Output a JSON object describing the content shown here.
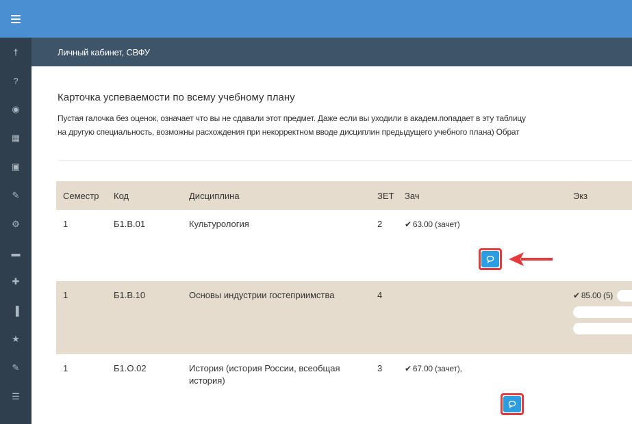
{
  "header": {
    "breadcrumb": "Личный кабинет, СВФУ"
  },
  "sidebar": {
    "items": [
      {
        "icon": "person-icon",
        "glyph": "†"
      },
      {
        "icon": "help-icon",
        "glyph": "?"
      },
      {
        "icon": "target-icon",
        "glyph": "◉"
      },
      {
        "icon": "table-icon",
        "glyph": "▦"
      },
      {
        "icon": "id-card-icon",
        "glyph": "▣"
      },
      {
        "icon": "edit-icon",
        "glyph": "✎"
      },
      {
        "icon": "cogs-icon",
        "glyph": "⚙"
      },
      {
        "icon": "book-icon",
        "glyph": "▬"
      },
      {
        "icon": "plus-square-icon",
        "glyph": "✚"
      },
      {
        "icon": "chart-icon",
        "glyph": "▐"
      },
      {
        "icon": "star-icon",
        "glyph": "★"
      },
      {
        "icon": "edit-icon",
        "glyph": "✎"
      },
      {
        "icon": "list-icon",
        "glyph": "☰"
      }
    ]
  },
  "page": {
    "title": "Карточка успеваемости по всему учебному плану",
    "desc_line1": "Пустая галочка без оценок, означает что вы не сдавали этот предмет. Даже если вы уходили в академ.попадает в эту таблицу",
    "desc_line2": "на другую специальность, возможны расхождения при некорректном вводе дисциплин предыдущего учебного плана) Обрат"
  },
  "table": {
    "headers": {
      "semester": "Семестр",
      "code": "Код",
      "discipline": "Дисциплина",
      "zet": "ЗЕТ",
      "zach": "Зач",
      "exz": "Экз"
    },
    "rows": [
      {
        "semester": "1",
        "code": "Б1.В.01",
        "discipline": "Культурология",
        "zet": "2",
        "zach": "63.00 (зачет)",
        "exz": ""
      },
      {
        "semester": "1",
        "code": "Б1.В.10",
        "discipline": "Основы индустрии гостеприимства",
        "zet": "4",
        "zach": "",
        "exz": "85.00 (5)"
      },
      {
        "semester": "1",
        "code": "Б1.О.02",
        "discipline": "История (история России, всеобщая история)",
        "zet": "3",
        "zach": "67.00 (зачет),",
        "exz": ""
      }
    ]
  },
  "colors": {
    "topbar": "#4a8fd1",
    "subbar": "#3e5468",
    "sidebar": "#2f3f4e",
    "row_shade": "#e5dccd",
    "comment_button": "#2c9de0",
    "highlight": "#e33b3b"
  }
}
